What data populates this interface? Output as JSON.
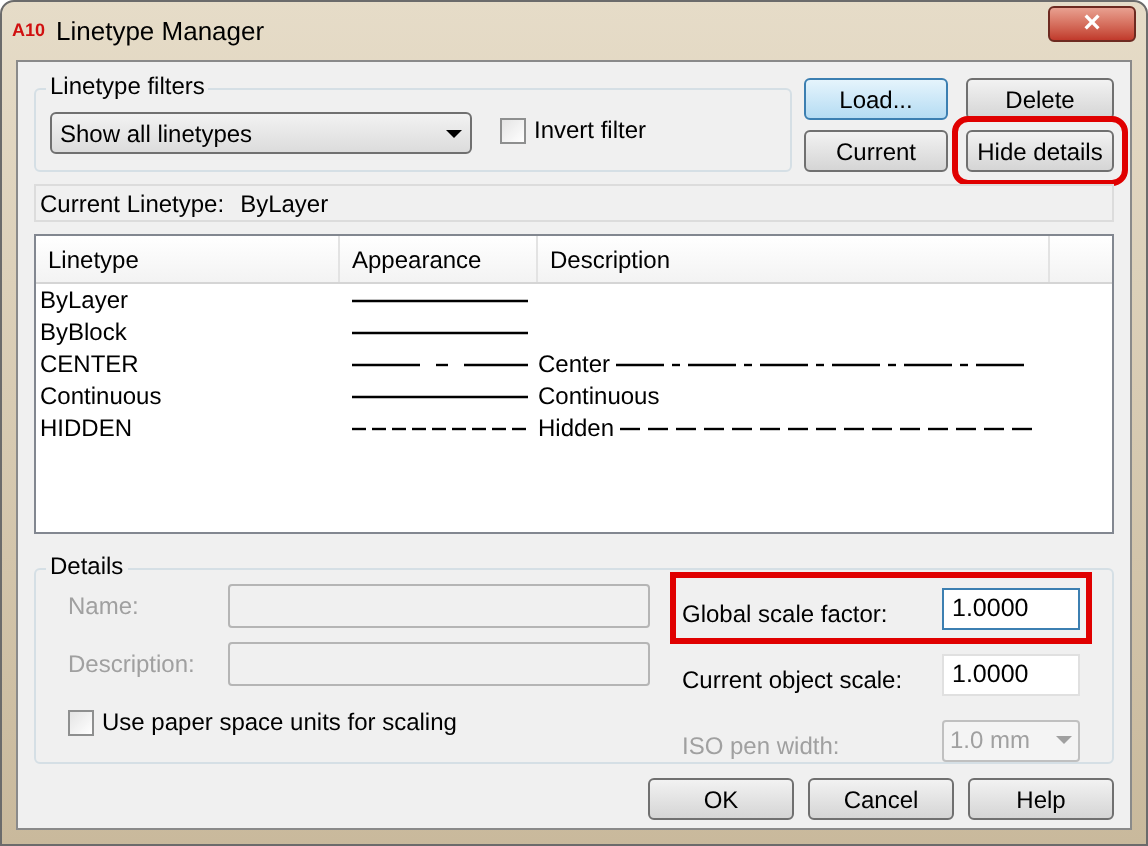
{
  "window": {
    "title": "Linetype Manager",
    "app_icon_text": "A10",
    "close": "×"
  },
  "filters": {
    "legend": "Linetype filters",
    "dropdown": "Show all linetypes",
    "invert": {
      "label": "Invert filter",
      "checked": false
    }
  },
  "top_buttons": [
    {
      "label": "Load...",
      "default": true,
      "highlighted": false
    },
    {
      "label": "Delete",
      "default": false,
      "highlighted": false
    },
    {
      "label": "Current",
      "default": false,
      "highlighted": false
    },
    {
      "label": "Hide details",
      "default": false,
      "highlighted": true
    }
  ],
  "current_linetype": {
    "label": "Current Linetype:",
    "value": "ByLayer"
  },
  "table": {
    "columns": [
      "Linetype",
      "Appearance",
      "Description"
    ],
    "rows": [
      {
        "name": "ByLayer",
        "appearance": {
          "kind": "continuous"
        }
      },
      {
        "name": "ByBlock",
        "appearance": {
          "kind": "continuous"
        }
      },
      {
        "name": "CENTER",
        "appearance": {
          "kind": "center"
        },
        "description": "Center",
        "description_line": {
          "kind": "center"
        }
      },
      {
        "name": "Continuous",
        "appearance": {
          "kind": "continuous"
        },
        "description": "Continuous"
      },
      {
        "name": "HIDDEN",
        "appearance": {
          "kind": "hidden"
        },
        "description": "Hidden",
        "description_line": {
          "kind": "hidden"
        }
      }
    ]
  },
  "details": {
    "legend": "Details",
    "name": {
      "label": "Name:",
      "disabled": true
    },
    "description": {
      "label": "Description:",
      "disabled": true
    },
    "paper_space": {
      "label": "Use paper space units for scaling",
      "checked": false
    },
    "global_scale": {
      "label": "Global scale factor:",
      "value": "1.0000",
      "highlighted": true
    },
    "object_scale": {
      "label": "Current object scale:",
      "value": "1.0000",
      "highlighted": false
    },
    "pen_width": {
      "label": "ISO pen width:",
      "value": "1.0 mm",
      "disabled": true
    }
  },
  "bottom_buttons": [
    {
      "label": "OK"
    },
    {
      "label": "Cancel"
    },
    {
      "label": "Help"
    }
  ]
}
